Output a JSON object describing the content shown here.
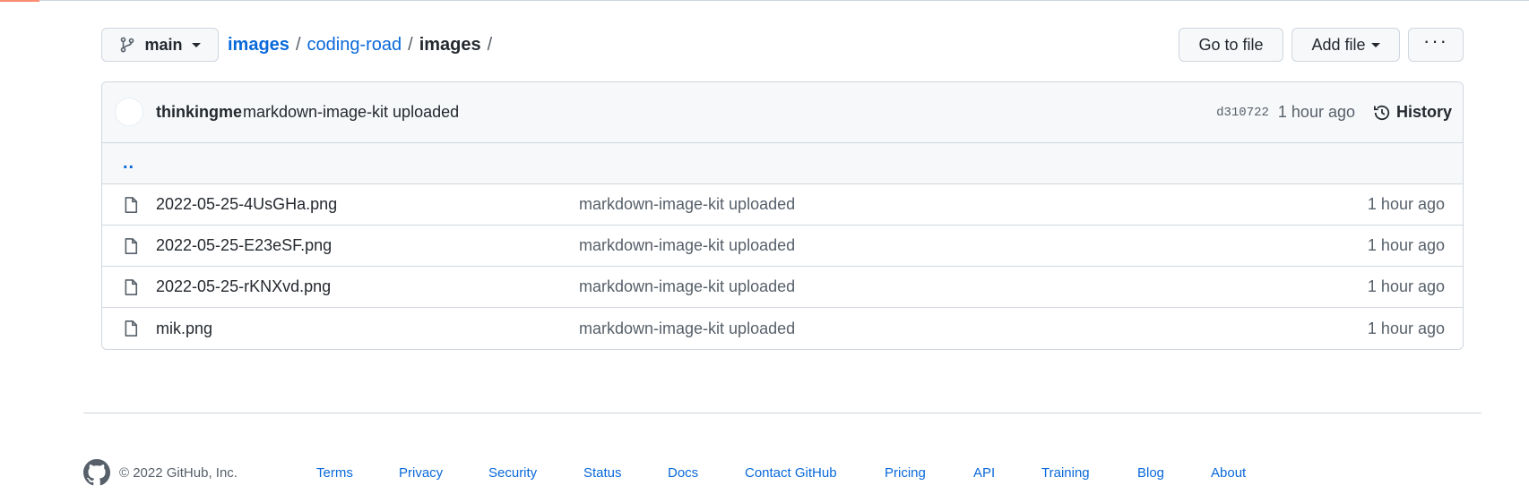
{
  "toolbar": {
    "branch_label": "main",
    "breadcrumb": {
      "repo": "images",
      "folder": "coding-road",
      "current": "images",
      "separator": "/"
    },
    "go_to_file": "Go to file",
    "add_file": "Add file",
    "more": "···"
  },
  "commit": {
    "author": "thinkingme",
    "message": "markdown-image-kit uploaded",
    "sha": "d310722",
    "time": "1 hour ago",
    "history_label": "History"
  },
  "parent_link": "..",
  "files": [
    {
      "name": "2022-05-25-4UsGHa.png",
      "message": "markdown-image-kit uploaded",
      "age": "1 hour ago"
    },
    {
      "name": "2022-05-25-E23eSF.png",
      "message": "markdown-image-kit uploaded",
      "age": "1 hour ago"
    },
    {
      "name": "2022-05-25-rKNXvd.png",
      "message": "markdown-image-kit uploaded",
      "age": "1 hour ago"
    },
    {
      "name": "mik.png",
      "message": "markdown-image-kit uploaded",
      "age": "1 hour ago"
    }
  ],
  "footer": {
    "copyright": "© 2022 GitHub, Inc.",
    "links": [
      "Terms",
      "Privacy",
      "Security",
      "Status",
      "Docs",
      "Contact GitHub",
      "Pricing",
      "API",
      "Training",
      "Blog",
      "About"
    ]
  },
  "colors": {
    "link": "#0969da",
    "border": "#d0d7de",
    "muted": "#57606a",
    "header_bg": "#f6f8fa"
  }
}
